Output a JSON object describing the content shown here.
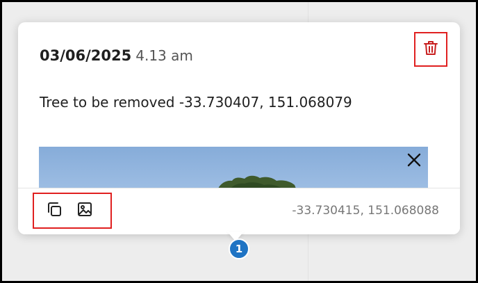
{
  "popup": {
    "date": "03/06/2025",
    "time": "4.13 am",
    "note": "Tree to be removed -33.730407, 151.068079",
    "footer_coords": "-33.730415, 151.068088"
  },
  "icons": {
    "delete": "trash-icon",
    "close": "close-icon",
    "copy": "copy-icon",
    "image": "image-icon"
  },
  "marker": {
    "label": "1"
  },
  "colors": {
    "highlight": "#e02020",
    "delete_icon": "#c81e1e",
    "marker": "#1f74c4"
  }
}
